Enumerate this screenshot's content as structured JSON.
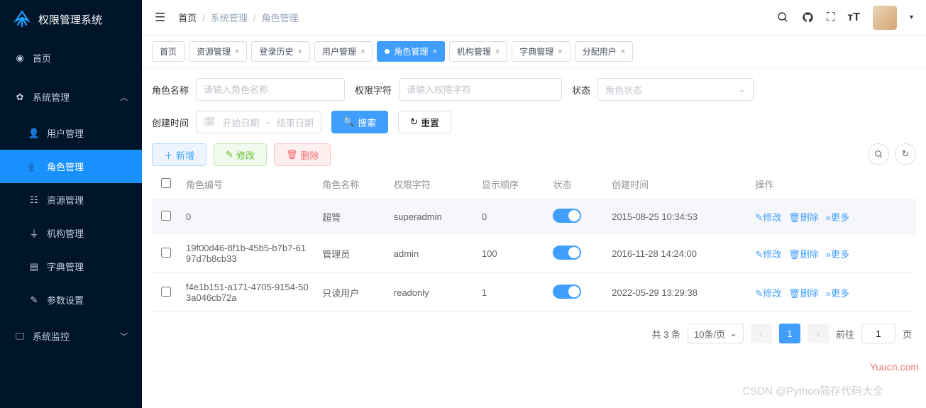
{
  "app": {
    "title": "权限管理系统"
  },
  "sidebar": {
    "items": [
      {
        "label": "首页",
        "icon": "dashboard-icon"
      },
      {
        "label": "系统管理",
        "icon": "gear-icon",
        "expanded": true
      },
      {
        "label": "用户管理",
        "icon": "user-icon",
        "sub": true
      },
      {
        "label": "角色管理",
        "icon": "users-icon",
        "sub": true,
        "active": true
      },
      {
        "label": "资源管理",
        "icon": "tree-icon",
        "sub": true
      },
      {
        "label": "机构管理",
        "icon": "sitemap-icon",
        "sub": true
      },
      {
        "label": "字典管理",
        "icon": "book-icon",
        "sub": true
      },
      {
        "label": "参数设置",
        "icon": "edit-icon",
        "sub": true
      },
      {
        "label": "系统监控",
        "icon": "monitor-icon"
      }
    ]
  },
  "breadcrumb": {
    "items": [
      "首页",
      "系统管理",
      "角色管理"
    ]
  },
  "tabs": [
    {
      "label": "首页"
    },
    {
      "label": "资源管理",
      "closable": true
    },
    {
      "label": "登录历史",
      "closable": true
    },
    {
      "label": "用户管理",
      "closable": true
    },
    {
      "label": "角色管理",
      "closable": true,
      "active": true
    },
    {
      "label": "机构管理",
      "closable": true
    },
    {
      "label": "字典管理",
      "closable": true
    },
    {
      "label": "分配用户",
      "closable": true
    }
  ],
  "search": {
    "role_name_label": "角色名称",
    "role_name_placeholder": "请输入角色名称",
    "perm_label": "权限字符",
    "perm_placeholder": "请输入权限字符",
    "status_label": "状态",
    "status_placeholder": "角色状态",
    "create_time_label": "创建时间",
    "start_date_placeholder": "开始日期",
    "end_date_placeholder": "结束日期",
    "search_btn": "搜索",
    "reset_btn": "重置"
  },
  "toolbar": {
    "add": "新增",
    "edit": "修改",
    "delete": "删除"
  },
  "table": {
    "columns": [
      "角色编号",
      "角色名称",
      "权限字符",
      "显示顺序",
      "状态",
      "创建时间",
      "操作"
    ],
    "actions": {
      "edit": "修改",
      "delete": "删除",
      "more": "更多"
    },
    "rows": [
      {
        "id": "0",
        "name": "超管",
        "perm": "superadmin",
        "order": "0",
        "status": true,
        "created": "2015-08-25 10:34:53"
      },
      {
        "id": "19f00d46-8f1b-45b5-b7b7-6197d7b8cb33",
        "name": "管理员",
        "perm": "admin",
        "order": "100",
        "status": true,
        "created": "2016-11-28 14:24:00"
      },
      {
        "id": "f4e1b151-a171-4705-9154-503a046cb72a",
        "name": "只读用户",
        "perm": "readonly",
        "order": "1",
        "status": true,
        "created": "2022-05-29 13:29:38"
      }
    ]
  },
  "pagination": {
    "total_text": "共 3 条",
    "page_size_text": "10条/页",
    "current": "1",
    "goto_label": "前往",
    "page_suffix": "页"
  },
  "watermarks": {
    "right": "Yuucn.com",
    "bottom": "CSDN @Python简存代码大全"
  }
}
